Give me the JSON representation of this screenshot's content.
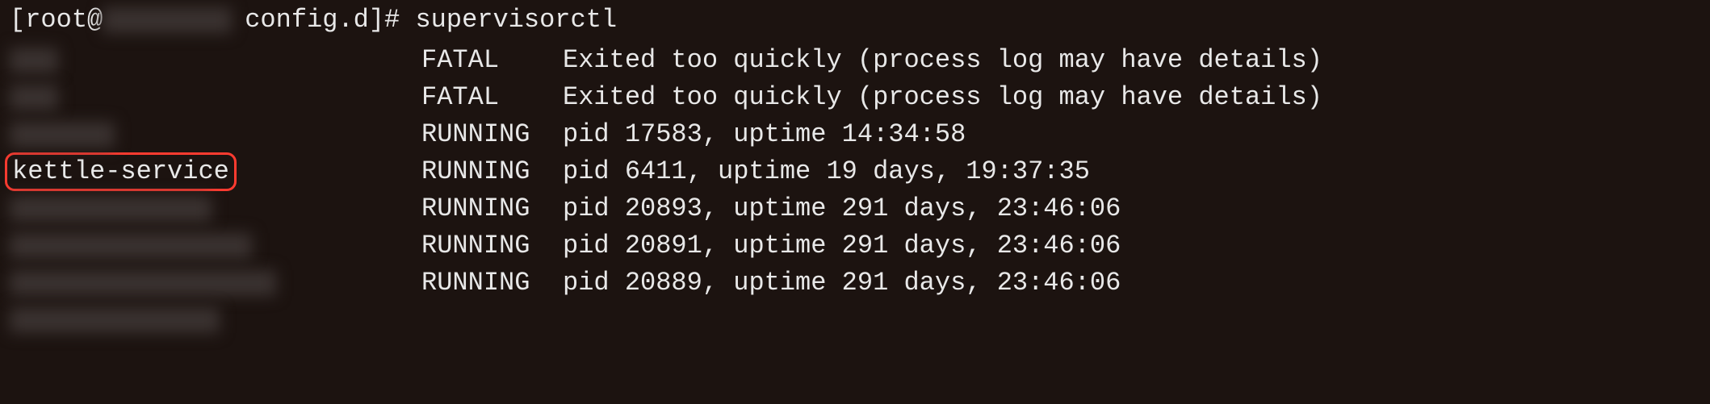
{
  "prompt": {
    "user": "root",
    "at": "@",
    "dir": "config.d",
    "symbol": "#",
    "command": "supervisorctl"
  },
  "processes": [
    {
      "name_visible": false,
      "name": "",
      "status": "FATAL",
      "detail": "Exited too quickly (process log may have details)"
    },
    {
      "name_visible": false,
      "name": "",
      "status": "FATAL",
      "detail": "Exited too quickly (process log may have details)"
    },
    {
      "name_visible": false,
      "name": "",
      "status": "RUNNING",
      "detail": "pid 17583, uptime 14:34:58"
    },
    {
      "name_visible": true,
      "name": "kettle-service",
      "status": "RUNNING",
      "detail": "pid 6411, uptime 19 days, 19:37:35"
    },
    {
      "name_visible": false,
      "name": "",
      "status": "RUNNING",
      "detail": "pid 20893, uptime 291 days, 23:46:06"
    },
    {
      "name_visible": false,
      "name": "",
      "status": "RUNNING",
      "detail": "pid 20891, uptime 291 days, 23:46:06"
    },
    {
      "name_visible": false,
      "name": "",
      "status": "RUNNING",
      "detail": "pid 20889, uptime 291 days, 23:46:06"
    }
  ]
}
